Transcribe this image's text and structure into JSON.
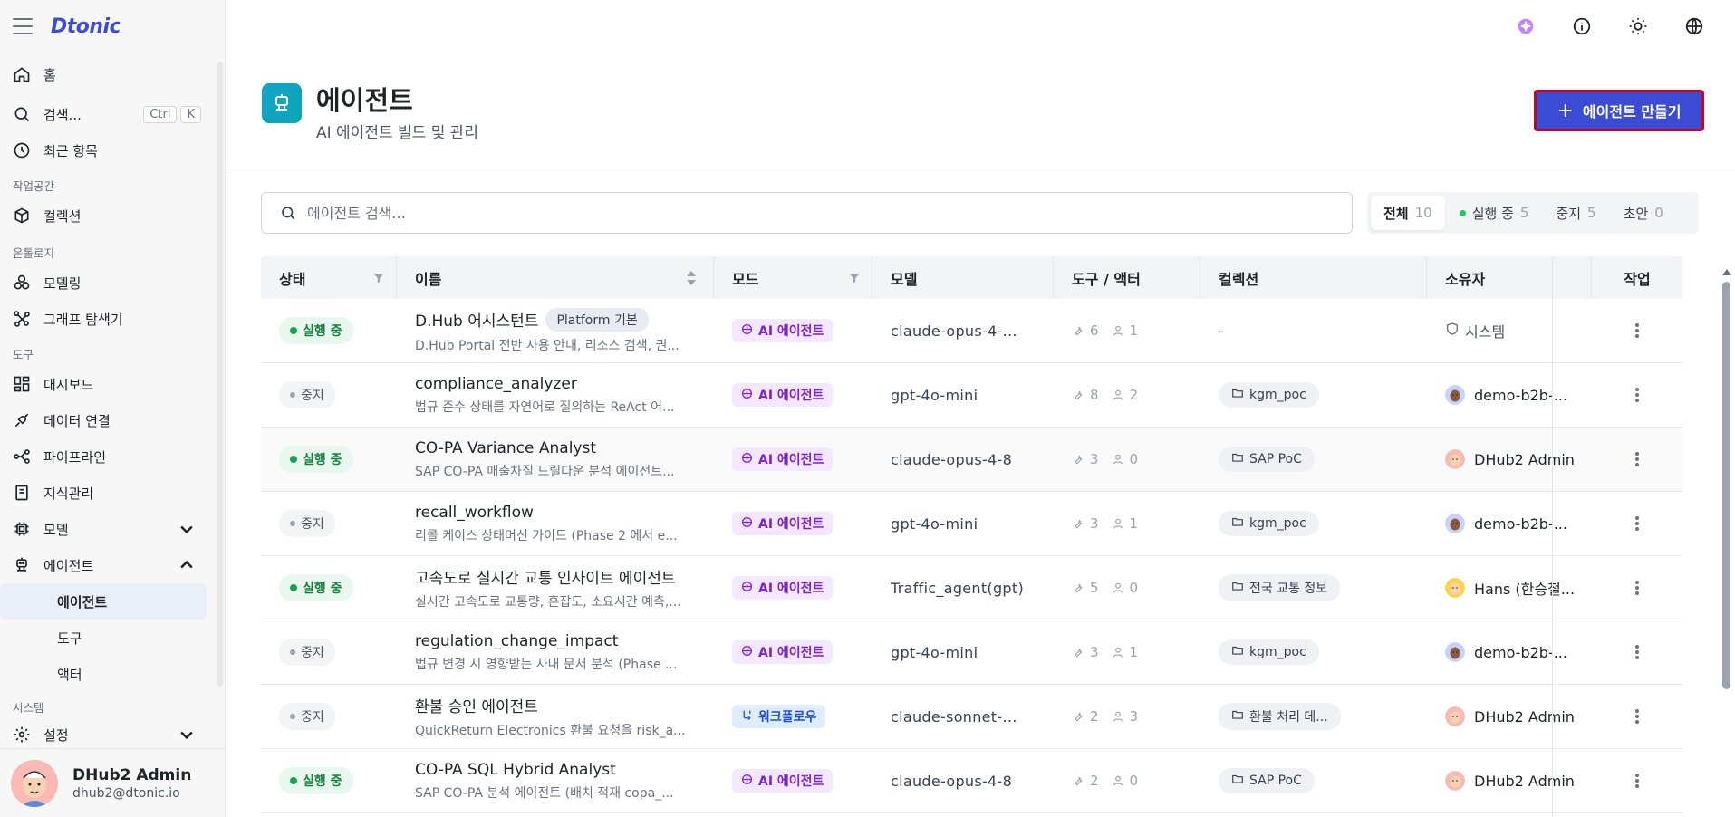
{
  "app": {
    "logo": "Dtonic"
  },
  "sidebar": {
    "home": "홈",
    "search": "검색...",
    "search_kbd": [
      "Ctrl",
      "K"
    ],
    "recent": "최근 항목",
    "sec_workspace": "작업공간",
    "collection": "컬렉션",
    "sec_ontology": "온톨로지",
    "modeling": "모델링",
    "graph": "그래프 탐색기",
    "sec_tools": "도구",
    "dashboard": "대시보드",
    "data_conn": "데이터 연결",
    "pipeline": "파이프라인",
    "knowledge": "지식관리",
    "model": "모델",
    "agent": "에이전트",
    "agent_sub": [
      "에이전트",
      "도구",
      "액터"
    ],
    "sec_system": "시스템",
    "settings": "설정",
    "user": {
      "name": "DHub2 Admin",
      "email": "dhub2@dtonic.io"
    }
  },
  "header": {
    "title": "에이전트",
    "subtitle": "AI 에이전트 빌드 및 관리",
    "create_label": "에이전트 만들기"
  },
  "search": {
    "placeholder": "에이전트 검색..."
  },
  "filters": [
    {
      "label": "전체",
      "count": "10"
    },
    {
      "label": "실행 중",
      "count": "5"
    },
    {
      "label": "중지",
      "count": "5"
    },
    {
      "label": "초안",
      "count": "0"
    }
  ],
  "table": {
    "headers": [
      "상태",
      "이름",
      "모드",
      "모델",
      "도구 / 액터",
      "컬렉션",
      "소유자",
      "작업"
    ],
    "rows": [
      {
        "status": "실행 중",
        "running": true,
        "name": "D.Hub 어시스턴트",
        "tag": "Platform 기본",
        "desc": "D.Hub Portal 전반 사용 안내, 리소스 검색, 권...",
        "mode": "AI 에이전트",
        "mode_type": "ai",
        "model": "claude-opus-4-...",
        "tools": "6",
        "actors": "1",
        "collection": "-",
        "owner": "시스템",
        "owner_type": "system"
      },
      {
        "status": "중지",
        "running": false,
        "name": "compliance_analyzer",
        "tag": "",
        "desc": "법규 준수 상태를 자연어로 질의하는 ReAct 어...",
        "mode": "AI 에이전트",
        "mode_type": "ai",
        "model": "gpt-4o-mini",
        "tools": "8",
        "actors": "2",
        "collection": "kgm_poc",
        "owner": "demo-b2b-...",
        "owner_type": "demo"
      },
      {
        "status": "실행 중",
        "running": true,
        "name": "CO-PA Variance Analyst",
        "tag": "",
        "desc": "SAP CO-PA 매출차질 드릴다운 분석 에이전트...",
        "mode": "AI 에이전트",
        "mode_type": "ai",
        "model": "claude-opus-4-8",
        "tools": "3",
        "actors": "0",
        "collection": "SAP PoC",
        "owner": "DHub2 Admin",
        "owner_type": "admin"
      },
      {
        "status": "중지",
        "running": false,
        "name": "recall_workflow",
        "tag": "",
        "desc": "리콜 케이스 상태머신 가이드 (Phase 2 에서 e...",
        "mode": "AI 에이전트",
        "mode_type": "ai",
        "model": "gpt-4o-mini",
        "tools": "3",
        "actors": "1",
        "collection": "kgm_poc",
        "owner": "demo-b2b-...",
        "owner_type": "demo"
      },
      {
        "status": "실행 중",
        "running": true,
        "name": "고속도로 실시간 교통 인사이트 에이전트",
        "tag": "",
        "desc": "실시간 고속도로 교통량, 혼잡도, 소요시간 예측,...",
        "mode": "AI 에이전트",
        "mode_type": "ai",
        "model": "Traffic_agent(gpt)",
        "tools": "5",
        "actors": "0",
        "collection": "전국 교통 정보",
        "owner": "Hans (한승철...",
        "owner_type": "hans"
      },
      {
        "status": "중지",
        "running": false,
        "name": "regulation_change_impact",
        "tag": "",
        "desc": "법규 변경 시 영향받는 사내 문서 분석 (Phase ...",
        "mode": "AI 에이전트",
        "mode_type": "ai",
        "model": "gpt-4o-mini",
        "tools": "3",
        "actors": "1",
        "collection": "kgm_poc",
        "owner": "demo-b2b-...",
        "owner_type": "demo"
      },
      {
        "status": "중지",
        "running": false,
        "name": "환불 승인 에이전트",
        "tag": "",
        "desc": "QuickReturn Electronics 환불 요청을 risk_a...",
        "mode": "워크플로우",
        "mode_type": "wf",
        "model": "claude-sonnet-...",
        "tools": "2",
        "actors": "3",
        "collection": "환불 처리 데...",
        "owner": "DHub2 Admin",
        "owner_type": "admin"
      },
      {
        "status": "실행 중",
        "running": true,
        "name": "CO-PA SQL Hybrid Analyst",
        "tag": "",
        "desc": "SAP CO-PA 분석 에이전트 (배치 적재 copa_...",
        "mode": "AI 에이전트",
        "mode_type": "ai",
        "model": "claude-opus-4-8",
        "tools": "2",
        "actors": "0",
        "collection": "SAP PoC",
        "owner": "DHub2 Admin",
        "owner_type": "admin"
      }
    ]
  },
  "colors": {
    "accent": "#3b4bd3",
    "running": "#16a34a",
    "ai_mode": "#7e22ce",
    "wf_mode": "#1d4ed8"
  },
  "icons": [
    "hamburger-icon",
    "home-icon",
    "search-icon",
    "clock-icon",
    "box-icon",
    "modeling-icon",
    "graph-icon",
    "dashboard-icon",
    "plug-icon",
    "pipeline-icon",
    "book-icon",
    "chip-icon",
    "robot-icon",
    "gear-icon",
    "ai-sparkle-icon",
    "info-icon",
    "sun-icon",
    "globe-icon",
    "plus-icon",
    "filter-icon",
    "sort-icon",
    "wrench-icon",
    "user-icon",
    "folder-icon",
    "shield-icon",
    "kebab-icon"
  ]
}
